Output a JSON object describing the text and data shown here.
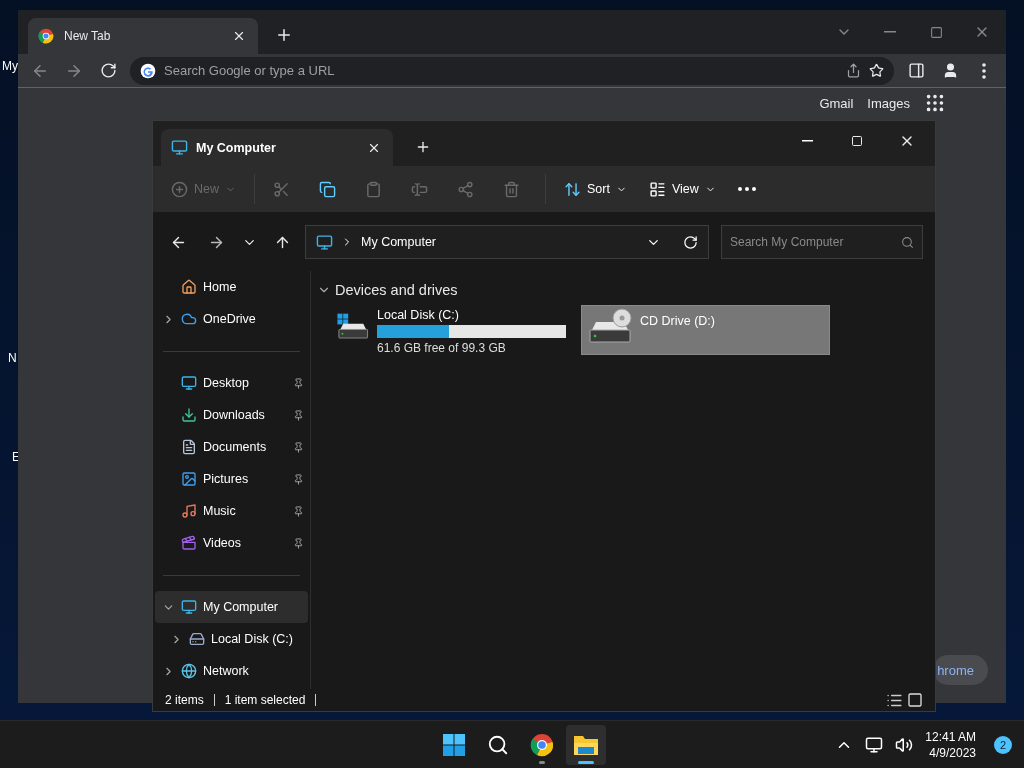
{
  "desktop_icons": [
    {
      "label": "My"
    },
    {
      "label": "N"
    },
    {
      "label": "E"
    }
  ],
  "browser": {
    "tab": {
      "title": "New Tab"
    },
    "omnibox": {
      "placeholder": "Search Google or type a URL"
    },
    "links": [
      "Gmail",
      "Images"
    ],
    "customize_button": "hrome"
  },
  "explorer": {
    "tab": {
      "title": "My Computer"
    },
    "toolbar": [
      {
        "kind": "new",
        "label": "New",
        "disabled": true
      },
      {
        "kind": "cut",
        "disabled": true
      },
      {
        "kind": "copy",
        "disabled": false
      },
      {
        "kind": "paste",
        "disabled": true
      },
      {
        "kind": "rename",
        "disabled": true
      },
      {
        "kind": "share",
        "disabled": true
      },
      {
        "kind": "delete",
        "disabled": true
      },
      {
        "kind": "sort",
        "label": "Sort",
        "disabled": false
      },
      {
        "kind": "view",
        "label": "View",
        "disabled": false
      },
      {
        "kind": "more",
        "disabled": false
      }
    ],
    "address": {
      "location": "My Computer"
    },
    "search": {
      "placeholder": "Search My Computer"
    },
    "nav_groups": [
      [
        {
          "label": "Home",
          "selected": false
        },
        {
          "label": "OneDrive",
          "expanded": false,
          "selected": false
        }
      ],
      [
        {
          "label": "Desktop",
          "selected": false,
          "pinned": true
        },
        {
          "label": "Downloads",
          "selected": false,
          "pinned": true
        },
        {
          "label": "Documents",
          "selected": false,
          "pinned": true
        },
        {
          "label": "Pictures",
          "selected": false,
          "pinned": true
        },
        {
          "label": "Music",
          "selected": false,
          "pinned": true
        },
        {
          "label": "Videos",
          "selected": false,
          "pinned": true
        }
      ],
      [
        {
          "label": "My Computer",
          "expanded": true,
          "selected": true,
          "children": [
            {
              "label": "Local Disk (C:)",
              "expanded": false,
              "selected": false
            }
          ]
        },
        {
          "label": "Network",
          "expanded": false,
          "selected": false
        }
      ]
    ],
    "section": {
      "title": "Devices and drives",
      "expanded": true
    },
    "drives": [
      {
        "name": "Local Disk (C:)",
        "kind": "disk",
        "level": 0.38,
        "reading": "61.6 GB free of 99.3 GB",
        "selected": false
      },
      {
        "name": "CD Drive (D:)",
        "kind": "cd",
        "selected": true
      }
    ],
    "status": {
      "count": "2 items",
      "selection": "1 item selected"
    }
  },
  "taskbar": {
    "apps": [
      {
        "kind": "start",
        "selected": false
      },
      {
        "kind": "search",
        "selected": false
      },
      {
        "kind": "chrome",
        "running": true,
        "selected": false
      },
      {
        "kind": "explorer",
        "running": true,
        "selected": true
      }
    ],
    "time": "12:41 AM",
    "date": "4/9/2023",
    "notifications": "2"
  }
}
